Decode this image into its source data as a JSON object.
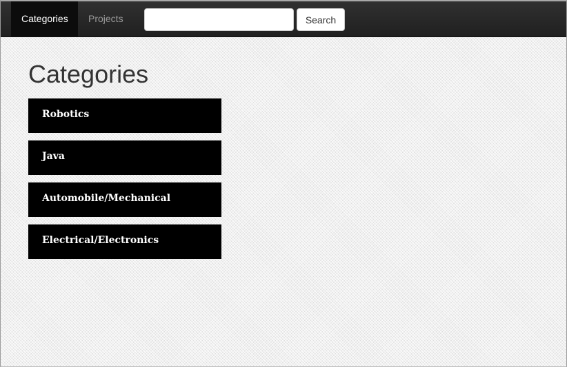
{
  "navbar": {
    "tabs": [
      {
        "label": "Categories",
        "active": true
      },
      {
        "label": "Projects",
        "active": false
      }
    ],
    "search": {
      "value": "",
      "placeholder": "",
      "button_label": "Search"
    }
  },
  "main": {
    "title": "Categories",
    "categories": [
      {
        "label": "Robotics"
      },
      {
        "label": "Java"
      },
      {
        "label": "Automobile/Mechanical"
      },
      {
        "label": "Electrical/Electronics"
      }
    ]
  },
  "colors": {
    "navbar_background": "#252525",
    "active_tab_background": "#0c0c0c",
    "inactive_tab_text": "#9a9a9a",
    "category_background": "#000000",
    "category_text": "#ffffff",
    "title_text": "#333333"
  }
}
